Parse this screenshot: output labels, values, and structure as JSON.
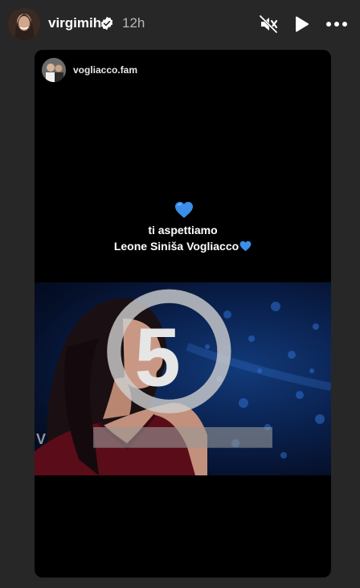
{
  "header": {
    "username": "virgimih",
    "time": "12h"
  },
  "story": {
    "repost_username": "vogliacco.fam",
    "caption_line1": "ti aspettiamo",
    "caption_line2": "Leone Siniša Vogliacco",
    "heart_color": "#3b8fe8"
  },
  "icons": [
    "verified-badge-icon",
    "mute-icon",
    "play-icon",
    "more-icon",
    "blue-heart-icon",
    "channel-logo-icon"
  ]
}
